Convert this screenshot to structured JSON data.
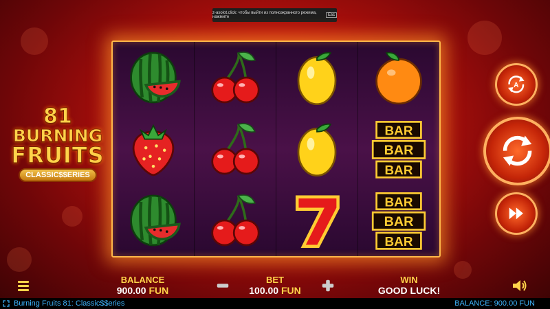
{
  "notice": {
    "text": "z-asolot.click: чтобы выйти из полноэкранного режима, нажмите",
    "key": "Esc"
  },
  "logo": {
    "number": "81",
    "line1": "BURNING",
    "line2": "FRUITS",
    "series": "CLASSIC$$ERIES"
  },
  "reels": [
    [
      "watermelon",
      "strawberry",
      "watermelon"
    ],
    [
      "cherry",
      "cherry",
      "cherry"
    ],
    [
      "lemon",
      "lemon",
      "seven"
    ],
    [
      "orange",
      "triple-bar",
      "triple-bar"
    ]
  ],
  "bar_text": "BAR",
  "balance": {
    "label": "BALANCE",
    "amount": "900.00",
    "currency": "FUN"
  },
  "bet": {
    "label": "BET",
    "amount": "100.00",
    "currency": "FUN"
  },
  "win": {
    "label": "WIN",
    "value": "GOOD LUCK!"
  },
  "footer": {
    "title": "Burning Fruits 81: Classic$$eries",
    "balance": "BALANCE: 900.00 FUN"
  },
  "colors": {
    "accent": "#ffd34a",
    "footer_text": "#3fb6ff",
    "frame_glow": "#ffb84a"
  }
}
